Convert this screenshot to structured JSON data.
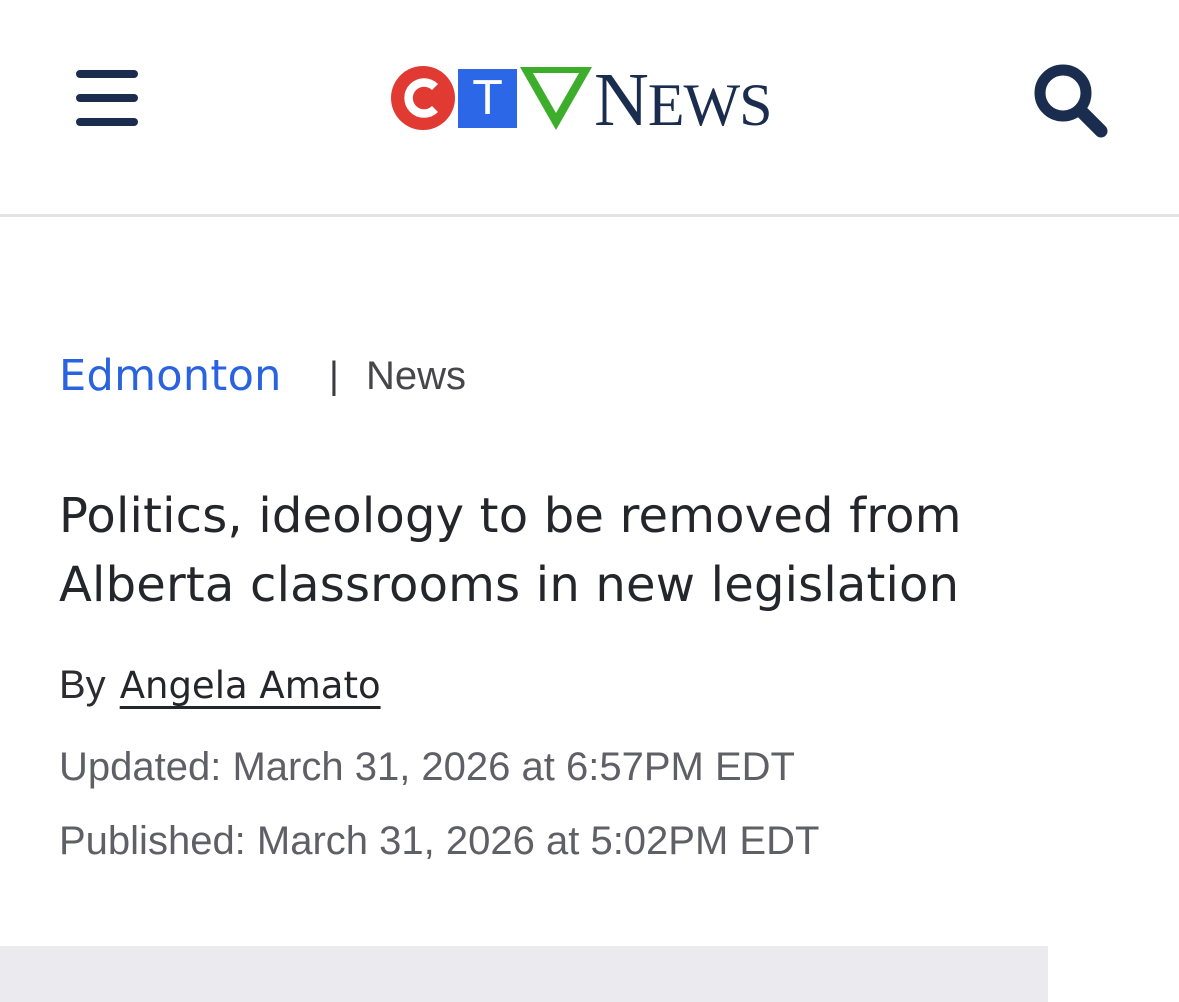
{
  "header": {
    "logo": {
      "letters": [
        "C",
        "T",
        "V"
      ],
      "wordmark_first": "N",
      "wordmark_rest": "EWS",
      "colors": {
        "c_red": "#e03a33",
        "t_blue": "#2c67e8",
        "v_green": "#3dae2b",
        "navy": "#1b2d4f"
      }
    },
    "menu_icon": "hamburger-menu-icon",
    "search_icon": "magnifier-search-icon"
  },
  "breadcrumb": {
    "section": "Edmonton",
    "separator": "|",
    "subsection": "News"
  },
  "article": {
    "headline": "Politics, ideology to be removed from Alberta classrooms in new legislation",
    "byline_prefix": "By",
    "author": "Angela Amato",
    "updated": "Updated: March 31, 2026 at 6:57PM EDT",
    "published": "Published: March 31, 2026 at 5:02PM EDT"
  },
  "colors": {
    "link_blue": "#2a63e0",
    "headline_text": "#25262b",
    "meta_gray": "#5f5f66",
    "divider": "#e3e3e6",
    "media_placeholder": "#ebebef"
  }
}
